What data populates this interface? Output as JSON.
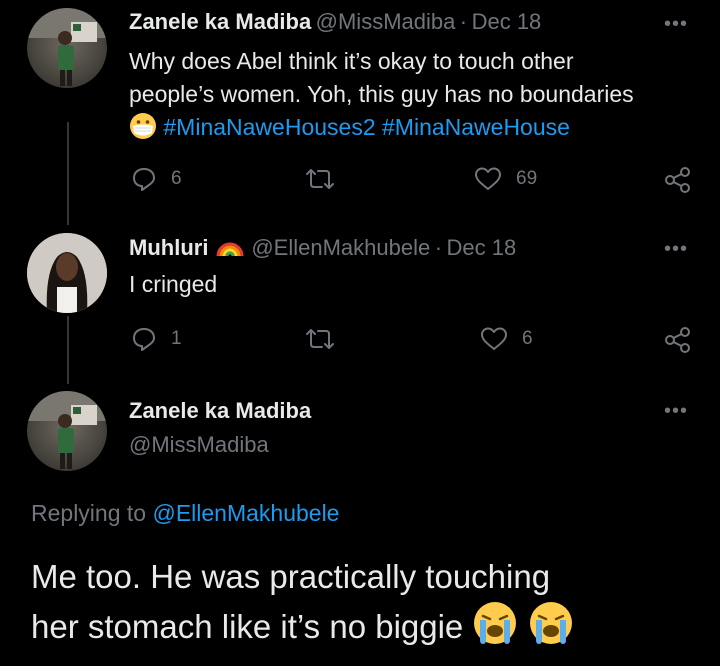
{
  "tweet1": {
    "name": "Zanele ka Madiba",
    "handle": "@MissMadiba",
    "date_sep": "·",
    "date": "Dec 18",
    "line1": "Why does Abel think it’s okay to touch other",
    "line2": "people’s women. Yoh, this guy has no boundaries",
    "hashtags": "#MinaNaweHouses2 #MinaNaweHouse",
    "replies": "6",
    "likes": "69"
  },
  "tweet2": {
    "name": "Muhluri",
    "handle": "@EllenMakhubele",
    "date_sep": "·",
    "date": "Dec 18",
    "text": "I cringed",
    "replies": "1",
    "likes": "6"
  },
  "main": {
    "name": "Zanele ka Madiba",
    "handle": "@MissMadiba",
    "replying_prefix": "Replying to",
    "replying_handle": "@EllenMakhubele",
    "line1": "Me too. He was practically touching",
    "line2": "her stomach like it’s no biggie"
  },
  "more_label": "•••",
  "icons": [
    "reply-icon",
    "retweet-icon",
    "like-icon",
    "share-icon",
    "more-icon",
    "rainbow-icon",
    "mask-face-icon",
    "crying-face-icon"
  ],
  "colors": {
    "background": "#000000",
    "text": "#e7e9ea",
    "muted": "#71767b",
    "link": "#1d9bf0"
  }
}
